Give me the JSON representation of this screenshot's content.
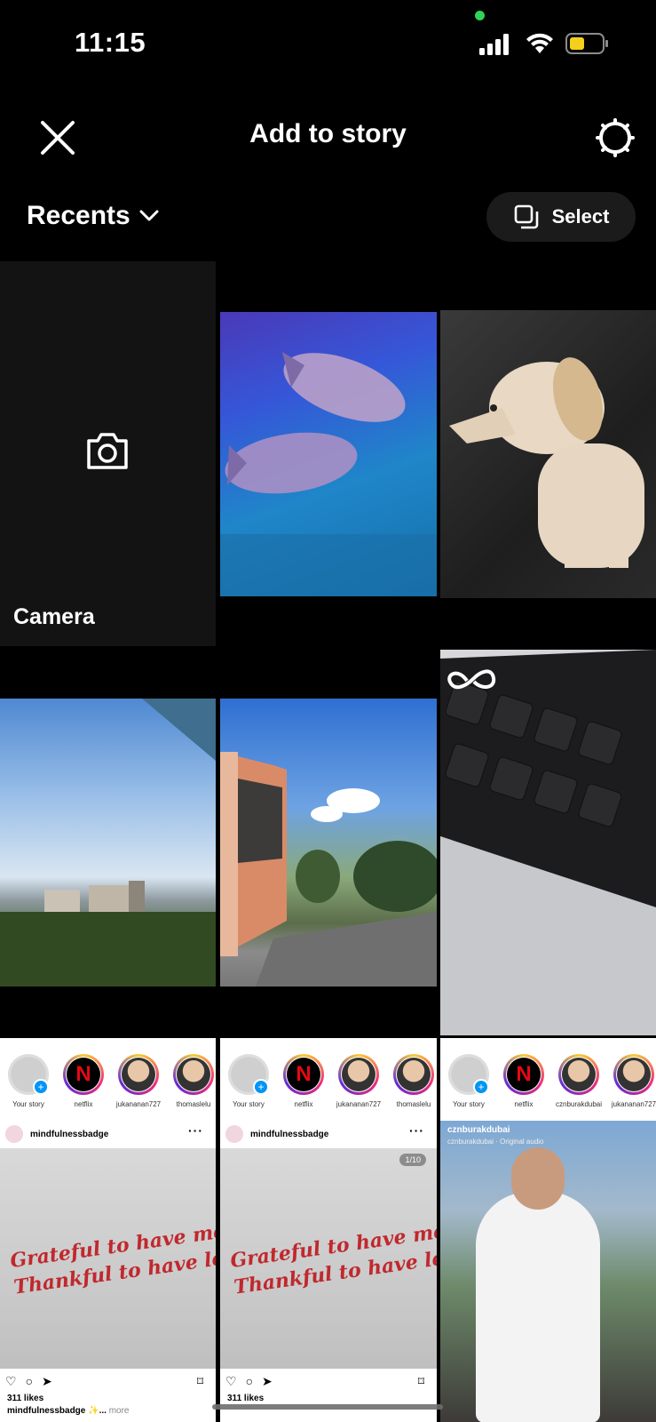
{
  "status_bar": {
    "time": "11:15"
  },
  "header": {
    "title": "Add to story"
  },
  "album": {
    "label": "Recents"
  },
  "select_button": {
    "label": "Select"
  },
  "camera_tile": {
    "label": "Camera"
  },
  "instagram_previews": [
    {
      "stories": [
        "Your story",
        "netflix",
        "jukananan727",
        "thomaslelu"
      ],
      "post_user": "mindfulnessbadge",
      "quote_line1": "Grateful to have met you,",
      "quote_line2": "Thankful to have let you go.",
      "likes": "311 likes",
      "caption_user": "mindfulnessbadge ✨...",
      "caption_more": "more"
    },
    {
      "stories": [
        "Your story",
        "netflix",
        "jukananan727",
        "thomaslelu"
      ],
      "post_user": "mindfulnessbadge",
      "counter": "1/10",
      "quote_line1": "Grateful to have met you,",
      "quote_line2": "Thankful to have let you go.",
      "likes": "311 likes"
    },
    {
      "stories": [
        "Your story",
        "netflix",
        "cznburakdubai",
        "jukananan727"
      ],
      "post_user": "cznburakdubai",
      "post_sub": "cznburakdubai · Original audio"
    }
  ],
  "colors": {
    "background": "#000000",
    "accent_green": "#2fd158",
    "netflix_red": "#e50914",
    "quote_red": "#c0282d"
  }
}
